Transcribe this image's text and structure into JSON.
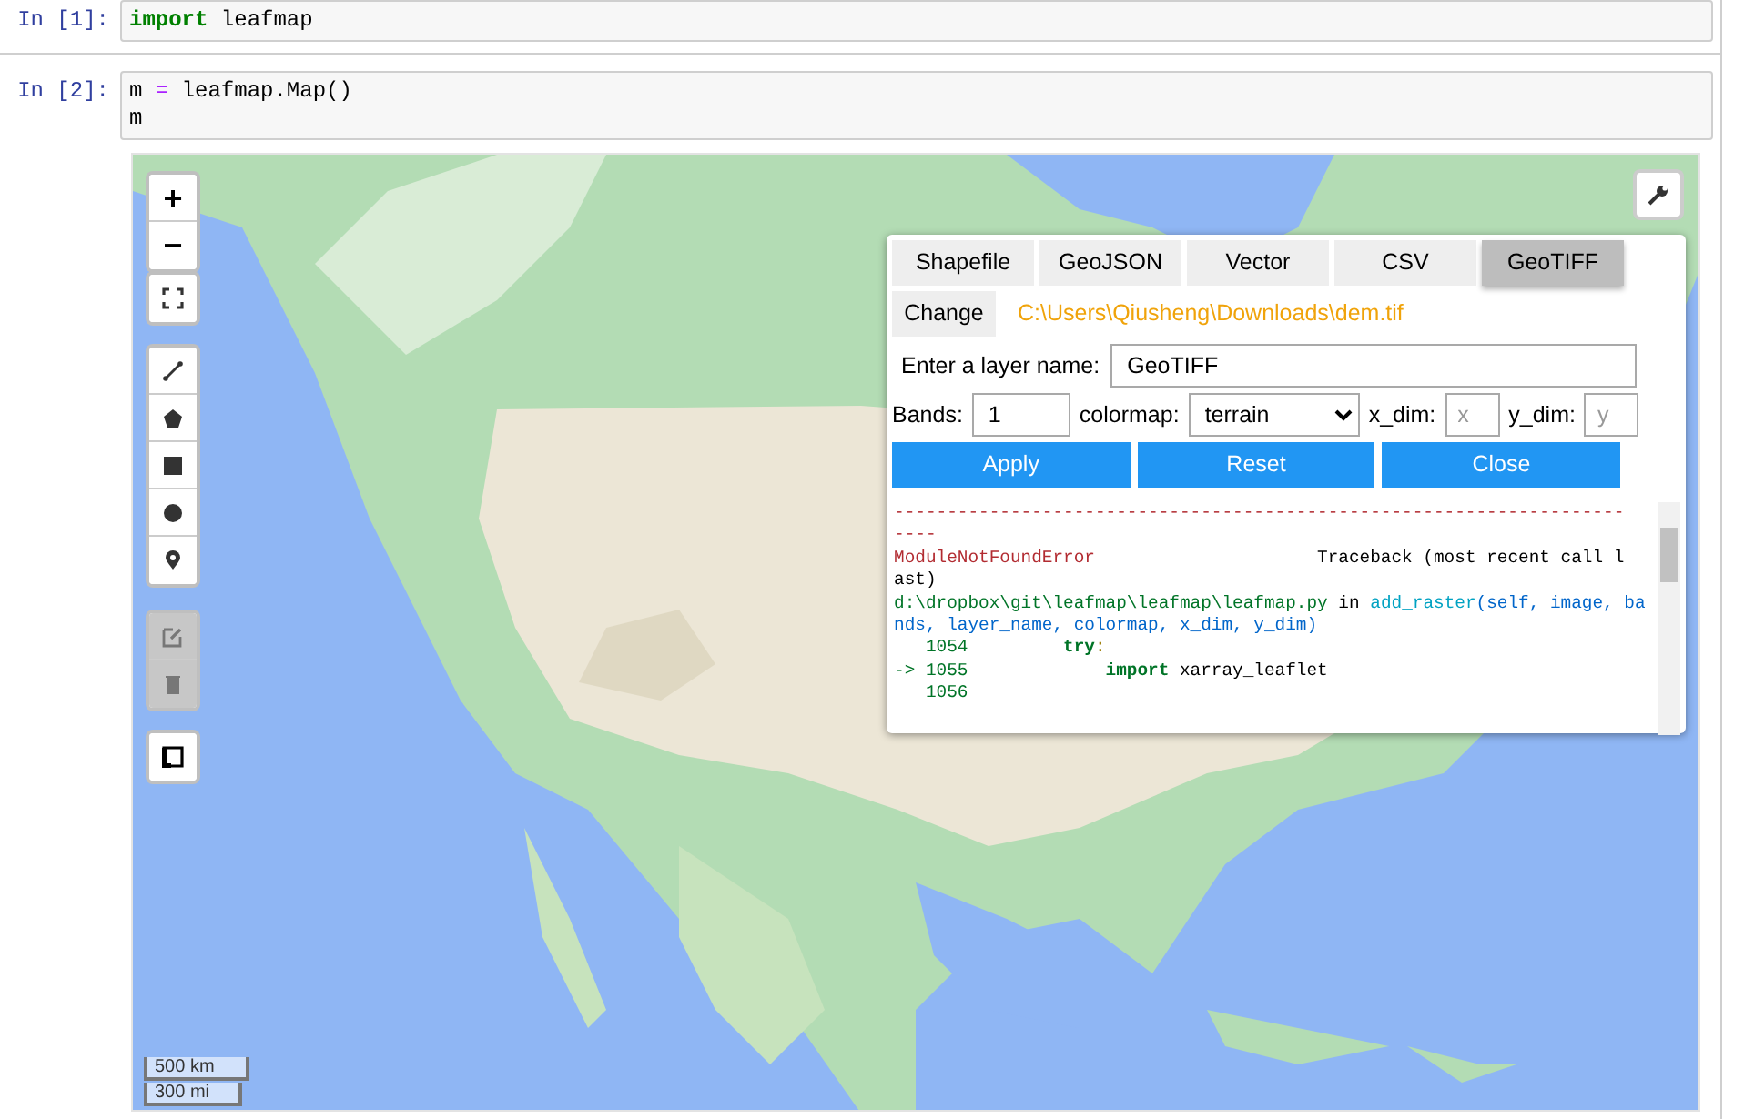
{
  "cells": [
    {
      "prompt": "In [1]:",
      "lines": [
        [
          {
            "text": "import",
            "kind": "keyword"
          },
          {
            "text": " leafmap",
            "kind": "plain"
          }
        ]
      ]
    },
    {
      "prompt": "In [2]:",
      "lines": [
        [
          {
            "text": "m ",
            "kind": "plain"
          },
          {
            "text": "=",
            "kind": "operator"
          },
          {
            "text": " leafmap.Map()",
            "kind": "plain"
          }
        ],
        [
          {
            "text": "m",
            "kind": "plain"
          }
        ]
      ]
    }
  ],
  "map": {
    "kind": "picture",
    "zoom_buttons": [
      "+",
      "−"
    ],
    "tool_groups": [
      [
        {
          "kind": "fullscreen",
          "disabled": false
        }
      ],
      [
        {
          "kind": "line",
          "disabled": false
        },
        {
          "kind": "polygon",
          "disabled": false
        },
        {
          "kind": "rectangle",
          "disabled": false
        },
        {
          "kind": "circle",
          "disabled": false
        },
        {
          "kind": "marker",
          "disabled": false
        }
      ],
      [
        {
          "kind": "edit",
          "disabled": true
        },
        {
          "kind": "delete",
          "disabled": true
        }
      ],
      [
        {
          "kind": "measure",
          "disabled": false
        }
      ]
    ],
    "scale": [
      "500 km",
      "300 mi"
    ]
  },
  "panel": {
    "tabs": [
      {
        "label": "Shapefile",
        "selected": false
      },
      {
        "label": "GeoJSON",
        "selected": false
      },
      {
        "label": "Vector",
        "selected": false
      },
      {
        "label": "CSV",
        "selected": false
      },
      {
        "label": "GeoTIFF",
        "selected": true
      }
    ],
    "change_button": "Change",
    "file_path": "C:\\Users\\Qiusheng\\Downloads\\dem.tif",
    "layer_label": "Enter a layer name:",
    "layer_value": "GeoTIFF",
    "bands_label": "Bands:",
    "bands_value": "1",
    "colormap_label": "colormap:",
    "colormap_value": "terrain",
    "xdim_label": "x_dim:",
    "xdim_placeholder": "x",
    "ydim_label": "y_dim:",
    "ydim_placeholder": "y",
    "buttons": [
      "Apply",
      "Reset",
      "Close"
    ],
    "output": [
      [
        {
          "text": "---------------------------------------------------------------------",
          "kind": "error"
        }
      ],
      [
        {
          "text": "----",
          "kind": "error"
        }
      ],
      [
        {
          "text": "ModuleNotFoundError",
          "kind": "error"
        },
        {
          "text": "                     Traceback (most recent call l",
          "kind": "plain"
        }
      ],
      [
        {
          "text": "ast)",
          "kind": "plain"
        }
      ],
      [
        {
          "text": "d:\\dropbox\\git\\leafmap\\leafmap\\leafmap.py",
          "kind": "path"
        },
        {
          "text": " in ",
          "kind": "plain"
        },
        {
          "text": "add_raster",
          "kind": "func"
        },
        {
          "text": "(self, image, ba",
          "kind": "args"
        }
      ],
      [
        {
          "text": "nds, layer_name, colormap, x_dim, y_dim)",
          "kind": "args"
        }
      ],
      [
        {
          "text": "   1054         ",
          "kind": "lineno"
        },
        {
          "text": "try",
          "kind": "keyword"
        },
        {
          "text": ":",
          "kind": "colon"
        }
      ],
      [
        {
          "text": "-> 1055             ",
          "kind": "lineno"
        },
        {
          "text": "import",
          "kind": "keyword"
        },
        {
          "text": " xarray_leaflet",
          "kind": "plain"
        }
      ],
      [
        {
          "text": "   1056",
          "kind": "lineno"
        }
      ]
    ]
  }
}
